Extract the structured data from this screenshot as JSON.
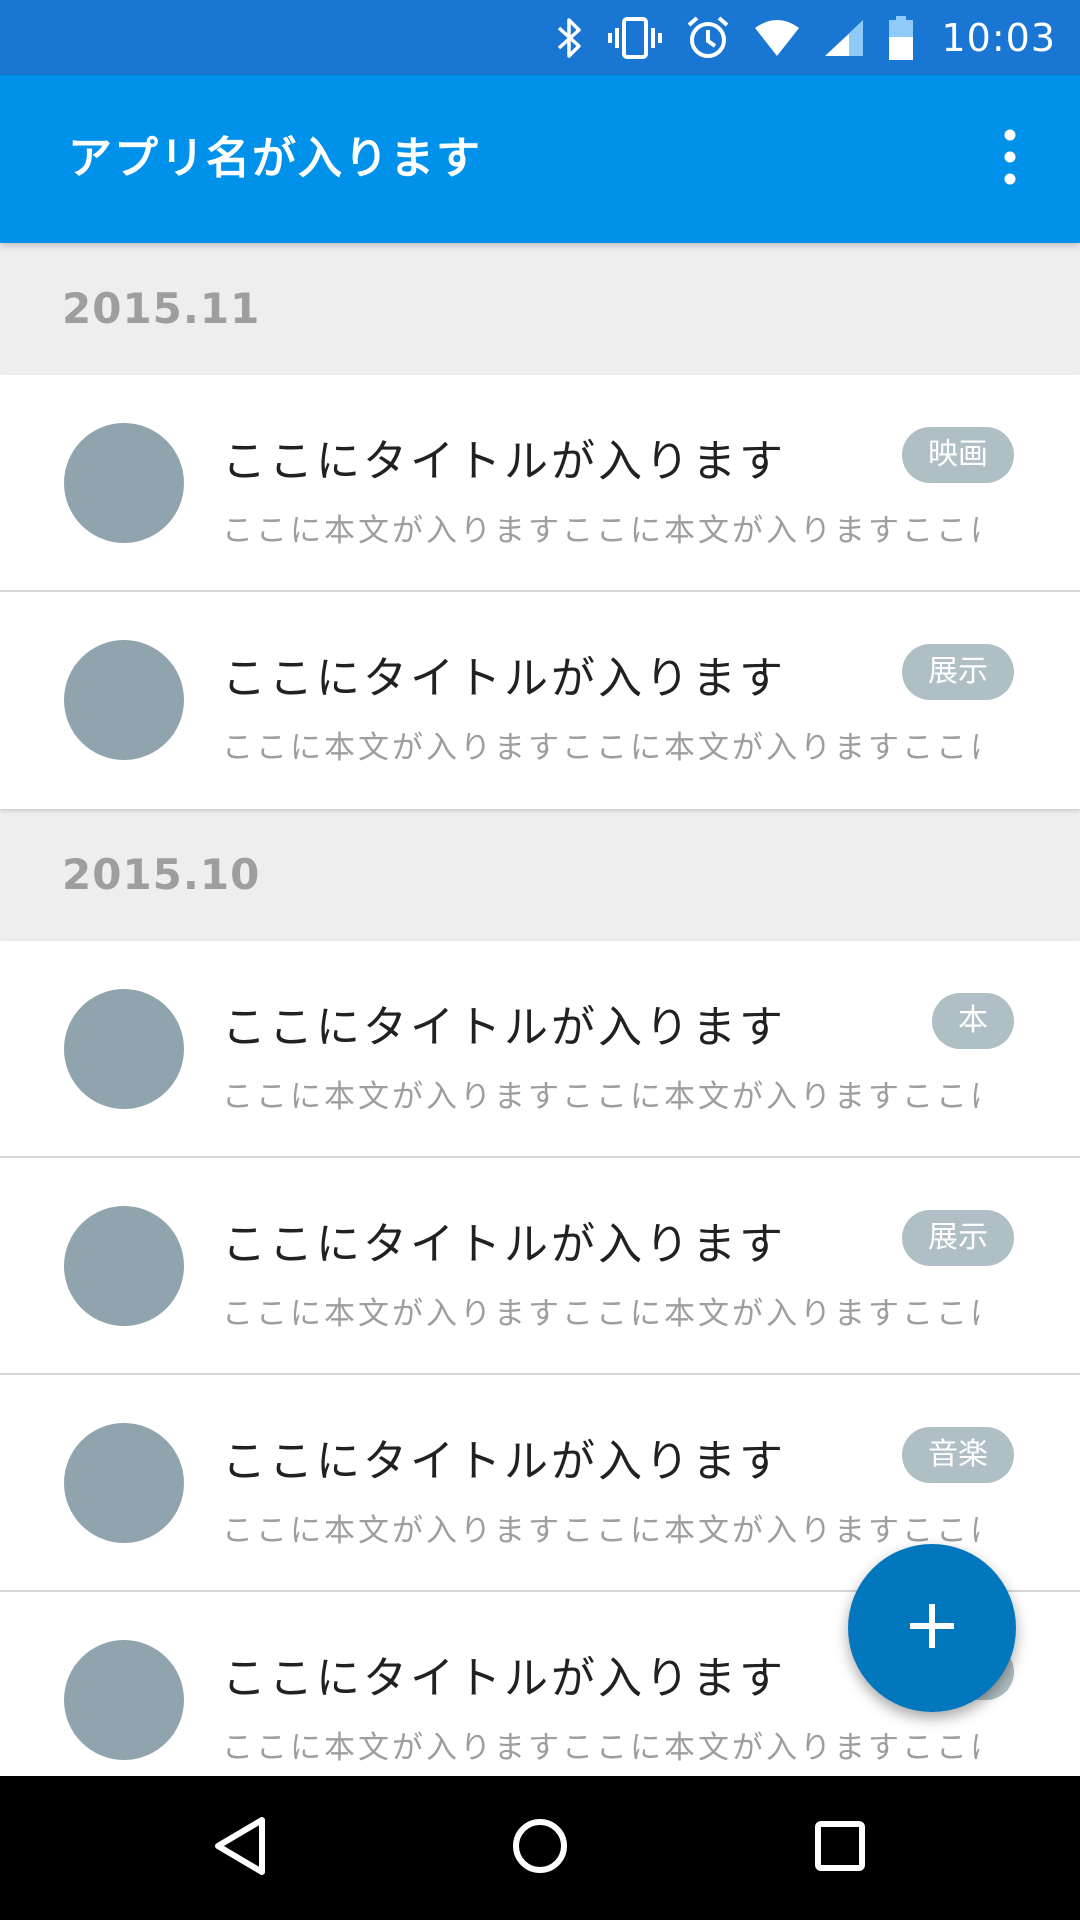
{
  "status_bar": {
    "time": "10:03",
    "icons": [
      "bluetooth-icon",
      "vibrate-icon",
      "alarm-icon",
      "wifi-icon",
      "cell-signal-icon",
      "battery-icon"
    ]
  },
  "app_bar": {
    "title": "アプリ名が入ります",
    "overflow_icon": "more-vert-icon"
  },
  "sections": [
    {
      "header": "2015.11",
      "items": [
        {
          "title": "ここにタイトルが入ります",
          "body": "ここに本文が入りますここに本文が入りますここに...",
          "tag": "映画"
        },
        {
          "title": "ここにタイトルが入ります",
          "body": "ここに本文が入りますここに本文が入りますここに...",
          "tag": "展示"
        }
      ]
    },
    {
      "header": "2015.10",
      "items": [
        {
          "title": "ここにタイトルが入ります",
          "body": "ここに本文が入りますここに本文が入りますここに...",
          "tag": "本"
        },
        {
          "title": "ここにタイトルが入ります",
          "body": "ここに本文が入りますここに本文が入りますここに...",
          "tag": "展示"
        },
        {
          "title": "ここにタイトルが入ります",
          "body": "ここに本文が入りますここに本文が入りますここに...",
          "tag": "音楽"
        },
        {
          "title": "ここにタイトルが入ります",
          "body": "ここに本文が入りますここに本文が入りますここに...",
          "tag": ""
        }
      ]
    }
  ],
  "fab": {
    "icon": "add-icon"
  },
  "nav_bar": {
    "icons": [
      "back-icon",
      "home-icon",
      "recents-icon"
    ]
  },
  "colors": {
    "status_bar": "#1976d2",
    "app_bar": "#0091ea",
    "fab": "#0277bd",
    "avatar": "#90a4ae",
    "tag": "#b0bec5",
    "section_header_bg": "#eeeeee"
  }
}
